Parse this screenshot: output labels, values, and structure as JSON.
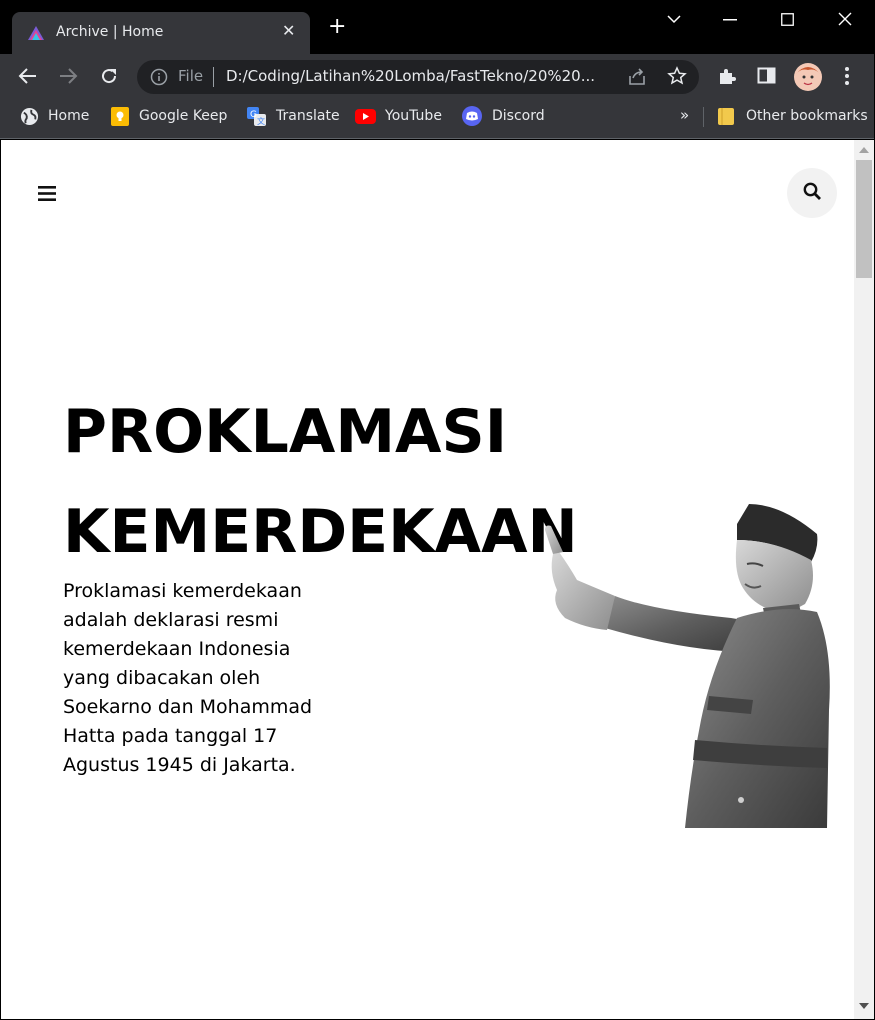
{
  "browser": {
    "tab": {
      "title": "Archive | Home"
    },
    "window_controls": [
      "minimize",
      "maximize",
      "close"
    ],
    "omnibox": {
      "scheme_label": "File",
      "url": "D:/Coding/Latihan%20Lomba/FastTekno/20%20..."
    },
    "bookmarks": [
      {
        "label": "Home",
        "icon": "globe-icon"
      },
      {
        "label": "Google Keep",
        "icon": "keep-icon"
      },
      {
        "label": "Translate",
        "icon": "translate-icon"
      },
      {
        "label": "YouTube",
        "icon": "youtube-icon"
      },
      {
        "label": "Discord",
        "icon": "discord-icon"
      }
    ],
    "bookmarks_overflow": "»",
    "other_bookmarks": "Other bookmarks"
  },
  "page": {
    "title_line1": "PROKLAMASI",
    "title_line2": "KEMERDEKAAN",
    "description": "Proklamasi kemerdekaan adalah deklarasi resmi kemerdekaan Indonesia yang dibacakan oleh Soekarno dan Mohammad Hatta pada tanggal 17 Agustus 1945 di Jakarta."
  },
  "colors": {
    "titlebar": "#000000",
    "toolbar": "#35363a",
    "omnibox": "#202124",
    "page_bg": "#ffffff"
  }
}
